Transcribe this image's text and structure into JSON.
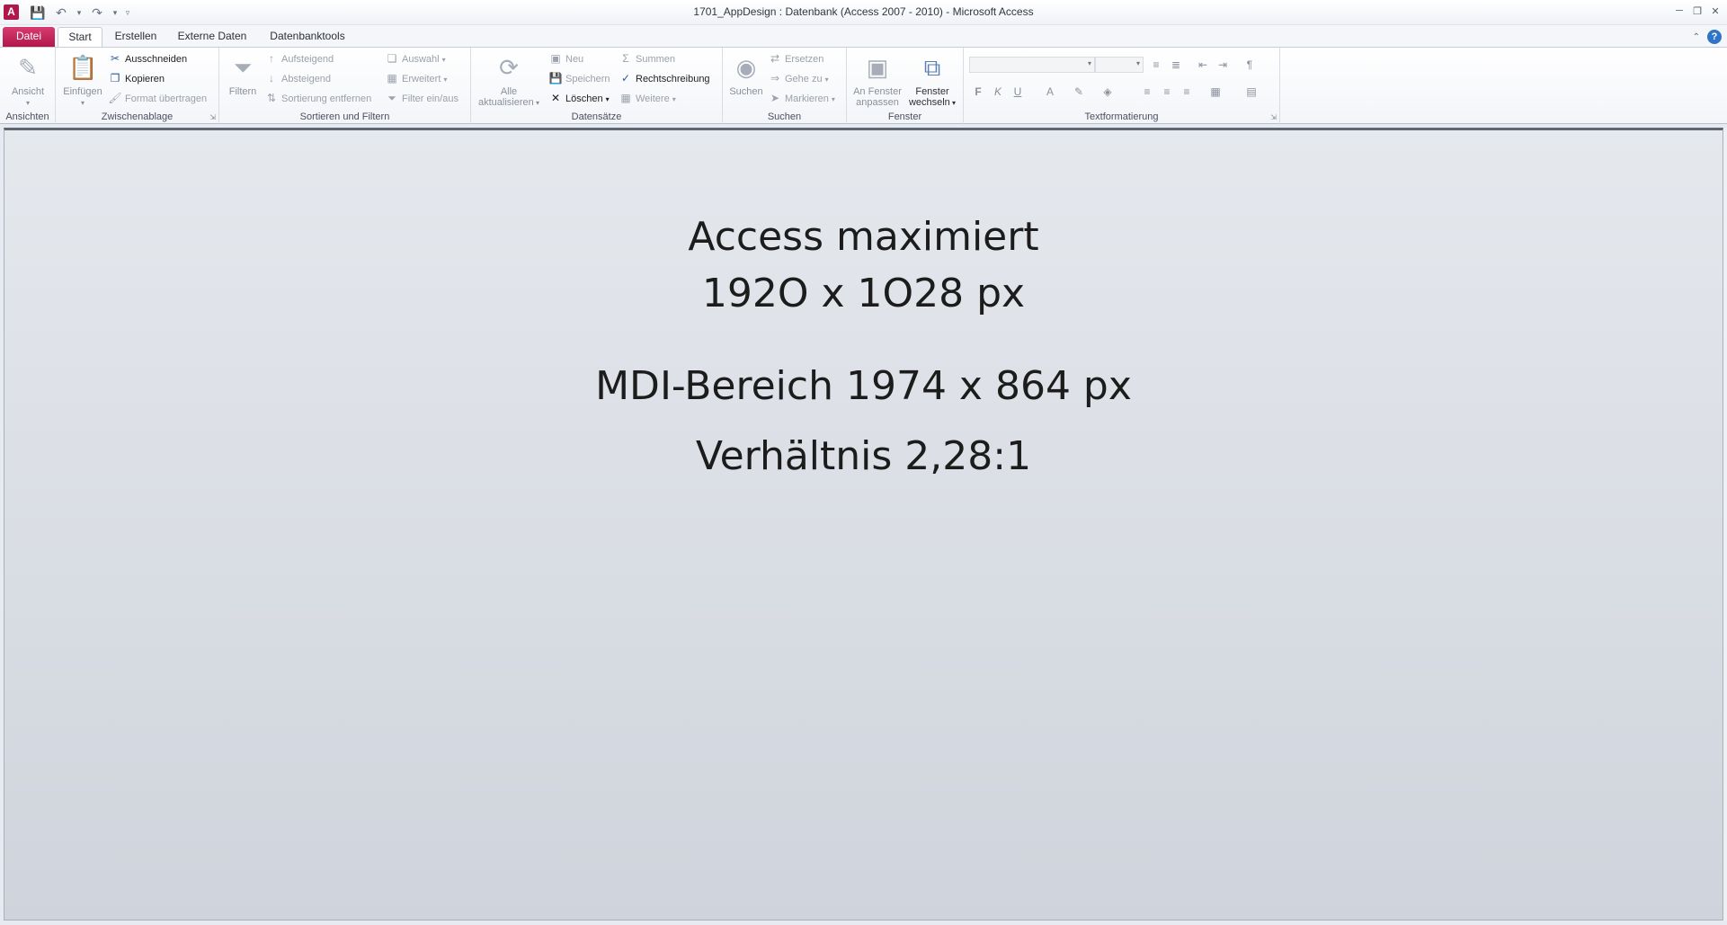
{
  "window": {
    "title": "1701_AppDesign : Datenbank (Access 2007 - 2010)  -  Microsoft Access",
    "app_icon": "A",
    "qat_icons": [
      "save-icon",
      "undo-icon",
      "redo-icon",
      "customize-icon"
    ]
  },
  "tabs": {
    "datei": "Datei",
    "start": "Start",
    "erstellen": "Erstellen",
    "extern": "Externe Daten",
    "dbtools": "Datenbanktools"
  },
  "ribbon": {
    "ansichten": {
      "label": "Ansichten",
      "ansicht": "Ansicht"
    },
    "zwischenablage": {
      "label": "Zwischenablage",
      "einfuegen": "Einfügen",
      "ausschneiden": "Ausschneiden",
      "kopieren": "Kopieren",
      "format": "Format übertragen"
    },
    "sortieren": {
      "label": "Sortieren und Filtern",
      "filtern": "Filtern",
      "aufsteigend": "Aufsteigend",
      "absteigend": "Absteigend",
      "entfernen": "Sortierung entfernen",
      "auswahl": "Auswahl",
      "erweitert": "Erweitert",
      "einaus": "Filter ein/aus"
    },
    "datensaetze": {
      "label": "Datensätze",
      "alle_1": "Alle",
      "alle_2": "aktualisieren",
      "neu": "Neu",
      "speichern": "Speichern",
      "loeschen": "Löschen",
      "summen": "Summen",
      "rechtschreibung": "Rechtschreibung",
      "weitere": "Weitere"
    },
    "suchen": {
      "label": "Suchen",
      "suchen": "Suchen",
      "ersetzen": "Ersetzen",
      "gehezu": "Gehe zu",
      "markieren": "Markieren"
    },
    "fenster": {
      "label": "Fenster",
      "anpassen_1": "An Fenster",
      "anpassen_2": "anpassen",
      "wechseln_1": "Fenster",
      "wechseln_2": "wechseln"
    },
    "text": {
      "label": "Textformatierung",
      "bold": "F",
      "italic": "K",
      "underline": "U"
    }
  },
  "mdi": {
    "line1": "Access maximiert",
    "line2": "192O x 1O28 px",
    "line3": "MDI-Bereich 1974 x 864 px",
    "line4": "Verhältnis 2,28:1"
  }
}
